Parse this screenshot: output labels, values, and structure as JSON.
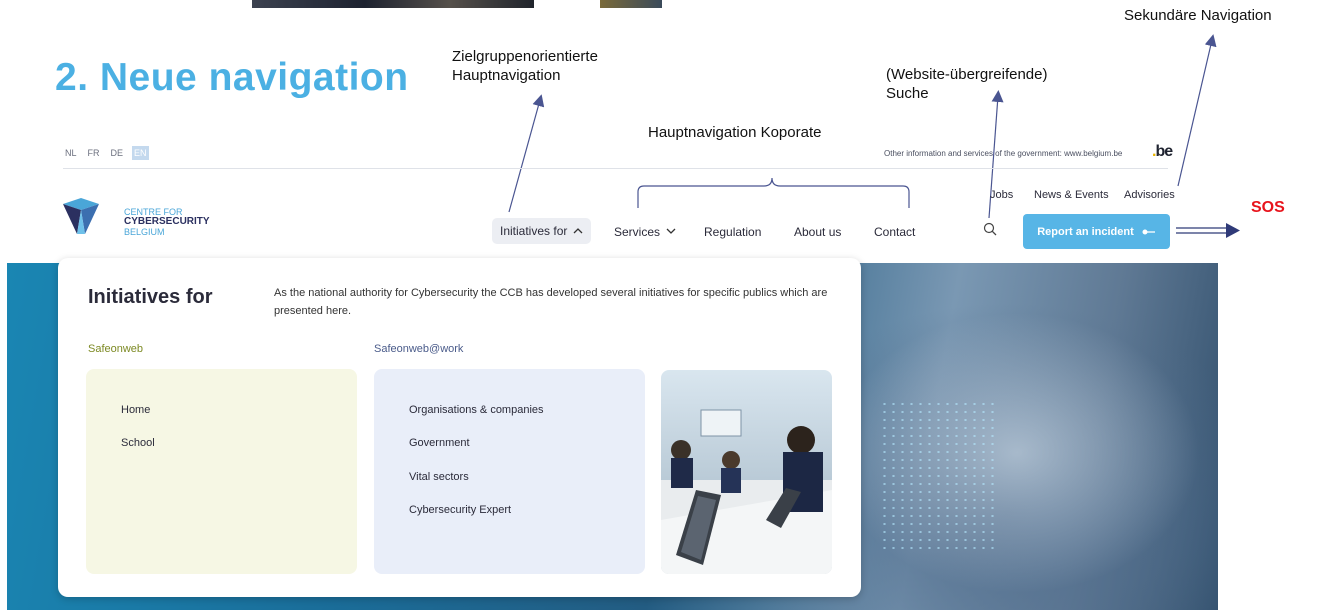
{
  "slide": {
    "title": "2. Neue navigation",
    "annotations": {
      "audience_nav": [
        "Zielgruppenorientierte",
        "Hauptnavigation"
      ],
      "corporate_nav": "Hauptnavigation Koporate",
      "search": [
        "(Website-übergreifende)",
        "Suche"
      ],
      "secondary_nav": "Sekundäre Navigation",
      "sos": "SOS"
    },
    "colors": {
      "title": "#4bb0e3",
      "sos": "#e8141c",
      "arrow": "#4a5591"
    }
  },
  "top_bar": {
    "languages": [
      {
        "label": "NL",
        "active": false
      },
      {
        "label": "FR",
        "active": false
      },
      {
        "label": "DE",
        "active": false
      },
      {
        "label": "EN",
        "active": true
      }
    ],
    "gov_info": "Other information and services of the government: www.belgium.be",
    "be_logo": "be"
  },
  "logo": {
    "line1": "CENTRE FOR",
    "line2": "CYBERSECURITY",
    "line3": "BELGIUM"
  },
  "secondary_nav": [
    "Jobs",
    "News & Events",
    "Advisories"
  ],
  "main_nav": {
    "initiatives": "Initiatives for",
    "services": "Services",
    "regulation": "Regulation",
    "about": "About us",
    "contact": "Contact"
  },
  "icons": {
    "search": "search-icon",
    "chevron_up": "chevron-up-icon",
    "chevron_down": "chevron-down-icon",
    "arrow": "arrow-right-icon"
  },
  "report_button": {
    "label": "Report an incident",
    "color": "#57b5e6"
  },
  "mega_menu": {
    "title": "Initiatives for",
    "description": "As the national authority for Cybersecurity the CCB has developed several initiatives for specific publics which are presented here.",
    "columns": [
      {
        "heading": "Safeonweb",
        "heading_color": "#7d8a24",
        "links": [
          "Home",
          "School"
        ]
      },
      {
        "heading": "Safeonweb@work",
        "heading_color": "#4a5b8a",
        "links": [
          "Organisations & companies",
          "Government",
          "Vital sectors",
          "Cybersecurity Expert"
        ]
      }
    ]
  }
}
